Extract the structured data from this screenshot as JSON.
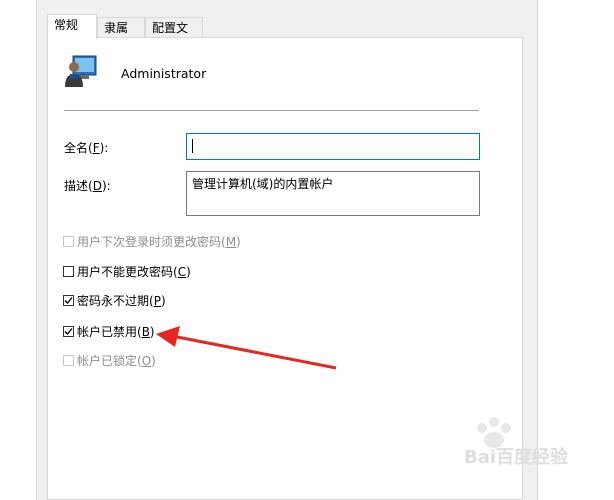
{
  "tabs": [
    {
      "label": "常规",
      "active": true
    },
    {
      "label": "隶属于",
      "active": false
    },
    {
      "label": "配置文件",
      "active": false
    }
  ],
  "user": {
    "name": "Administrator",
    "icon": "user-monitor-icon"
  },
  "fields": {
    "fullname": {
      "label": "全名(",
      "hotkey": "F",
      "suffix": "):",
      "value": ""
    },
    "description": {
      "label": "描述(",
      "hotkey": "D",
      "suffix": "):",
      "value": "管理计算机(域)的内置帐户"
    }
  },
  "checkboxes": [
    {
      "label": "用户下次登录时须更改密码(",
      "hotkey": "M",
      "suffix": ")",
      "checked": false,
      "disabled": true
    },
    {
      "label": "用户不能更改密码(",
      "hotkey": "C",
      "suffix": ")",
      "checked": false,
      "disabled": false
    },
    {
      "label": "密码永不过期(",
      "hotkey": "P",
      "suffix": ")",
      "checked": true,
      "disabled": false
    },
    {
      "label": "帐户已禁用(",
      "hotkey": "B",
      "suffix": ")",
      "checked": true,
      "disabled": false
    },
    {
      "label": "帐户已锁定(",
      "hotkey": "O",
      "suffix": ")",
      "checked": false,
      "disabled": true
    }
  ],
  "annotation": {
    "color": "#e8261f"
  },
  "watermark": {
    "text": "Bai百度经验"
  }
}
